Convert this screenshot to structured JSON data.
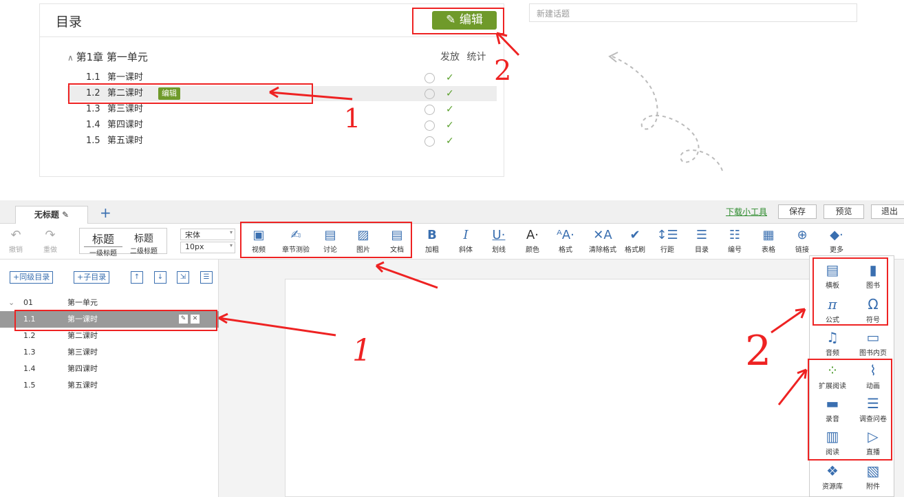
{
  "toc": {
    "title": "目录",
    "edit_label": "编辑",
    "chapter": "第1章 第一单元",
    "col_release": "发放",
    "col_stats": "统计",
    "rows": [
      {
        "num": "1.1",
        "name": "第一课时",
        "badge": ""
      },
      {
        "num": "1.2",
        "name": "第二课时",
        "badge": "编辑"
      },
      {
        "num": "1.3",
        "name": "第三课时",
        "badge": ""
      },
      {
        "num": "1.4",
        "name": "第四课时",
        "badge": ""
      },
      {
        "num": "1.5",
        "name": "第五课时",
        "badge": ""
      }
    ]
  },
  "topic_placeholder": "新建话题",
  "annotations": {
    "top_num1": "1",
    "top_num2": "2",
    "bot_num1": "1",
    "bot_num2": "2"
  },
  "editor": {
    "doc_tab": "无标题",
    "add_tab": "+",
    "download_tool": "下载小工具",
    "save": "保存",
    "preview": "预览",
    "exit": "退出",
    "undo": "撤销",
    "redo": "重做",
    "heading1_big": "标题",
    "heading1_small": "一级标题",
    "heading2_big": "标题",
    "heading2_small": "二级标题",
    "font_name": "宋体",
    "font_size": "10px",
    "tools": [
      "视频",
      "章节测验",
      "讨论",
      "图片",
      "文档",
      "加粗",
      "斜体",
      "划线",
      "颜色",
      "格式",
      "清除格式",
      "格式刷",
      "行距",
      "目录",
      "编号",
      "表格",
      "链接",
      "更多"
    ],
    "sidebar_buttons": {
      "same_level": "+同级目录",
      "child": "+子目录"
    },
    "tree": [
      {
        "num": "01",
        "title": "第一单元"
      },
      {
        "num": "1.1",
        "title": "第一课时"
      },
      {
        "num": "1.2",
        "title": "第二课时"
      },
      {
        "num": "1.3",
        "title": "第三课时"
      },
      {
        "num": "1.4",
        "title": "第四课时"
      },
      {
        "num": "1.5",
        "title": "第五课时"
      }
    ],
    "more_menu": [
      "横板",
      "图书",
      "公式",
      "符号",
      "音频",
      "图书内页",
      "扩展阅读",
      "动画",
      "录音",
      "调查问卷",
      "阅读",
      "直播",
      "资源库",
      "附件"
    ]
  }
}
